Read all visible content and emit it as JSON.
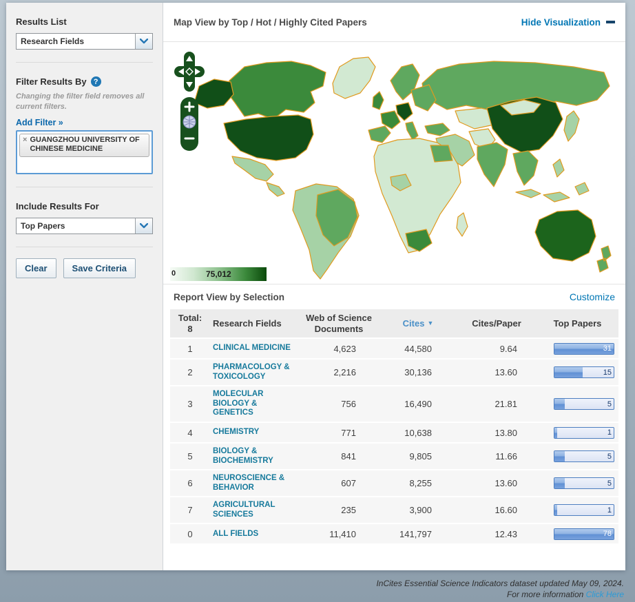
{
  "sidebar": {
    "results_list": {
      "label": "Results List",
      "selected": "Research Fields"
    },
    "filter": {
      "heading": "Filter Results By",
      "help_icon": "?",
      "note": "Changing the filter field removes all current filters.",
      "add_filter": "Add Filter »",
      "tag": {
        "remove_icon": "×",
        "label": "GUANGZHOU UNIVERSITY OF CHINESE MEDICINE"
      }
    },
    "include": {
      "label": "Include Results For",
      "selected": "Top Papers"
    },
    "buttons": {
      "clear": "Clear",
      "save": "Save Criteria"
    }
  },
  "map_view": {
    "title": "Map View by Top / Hot / Highly Cited Papers",
    "hide_link": "Hide Visualization",
    "scale": {
      "min": "0",
      "max": "75,012"
    },
    "palette": {
      "g1": "#f0f8f0",
      "g2": "#d2e9d2",
      "g3": "#a6d2a6",
      "g4": "#5fa85f",
      "g5": "#3b8a3b",
      "g6": "#1c641c",
      "g7": "#114f18",
      "map-border": "#e09a1f"
    }
  },
  "report": {
    "title": "Report View by Selection",
    "customize": "Customize",
    "table": {
      "headers": {
        "total_label": "Total:",
        "total_count": "8",
        "field": "Research Fields",
        "wos": "Web of Science Documents",
        "cites": "Cites",
        "sort_indicator": "▼",
        "cites_paper": "Cites/Paper",
        "top_papers": "Top Papers"
      },
      "rows": [
        {
          "rank": "1",
          "field": "CLINICAL MEDICINE",
          "wos": "4,623",
          "cites": "44,580",
          "cpp": "9.64",
          "top": "31",
          "bar_pct": 100
        },
        {
          "rank": "2",
          "field": "PHARMACOLOGY & TOXICOLOGY",
          "wos": "2,216",
          "cites": "30,136",
          "cpp": "13.60",
          "top": "15",
          "bar_pct": 48
        },
        {
          "rank": "3",
          "field": "MOLECULAR BIOLOGY & GENETICS",
          "wos": "756",
          "cites": "16,490",
          "cpp": "21.81",
          "top": "5",
          "bar_pct": 17
        },
        {
          "rank": "4",
          "field": "CHEMISTRY",
          "wos": "771",
          "cites": "10,638",
          "cpp": "13.80",
          "top": "1",
          "bar_pct": 5
        },
        {
          "rank": "5",
          "field": "BIOLOGY & BIOCHEMISTRY",
          "wos": "841",
          "cites": "9,805",
          "cpp": "11.66",
          "top": "5",
          "bar_pct": 17
        },
        {
          "rank": "6",
          "field": "NEUROSCIENCE & BEHAVIOR",
          "wos": "607",
          "cites": "8,255",
          "cpp": "13.60",
          "top": "5",
          "bar_pct": 17
        },
        {
          "rank": "7",
          "field": "AGRICULTURAL SCIENCES",
          "wos": "235",
          "cites": "3,900",
          "cpp": "16.60",
          "top": "1",
          "bar_pct": 5
        },
        {
          "rank": "0",
          "field": "ALL FIELDS",
          "wos": "11,410",
          "cites": "141,797",
          "cpp": "12.43",
          "top": "78",
          "bar_pct": 100
        }
      ]
    }
  },
  "footer": {
    "line1": "InCites Essential Science Indicators dataset updated May 09, 2024.",
    "line2_prefix": "For more information",
    "link": "Click Here"
  }
}
